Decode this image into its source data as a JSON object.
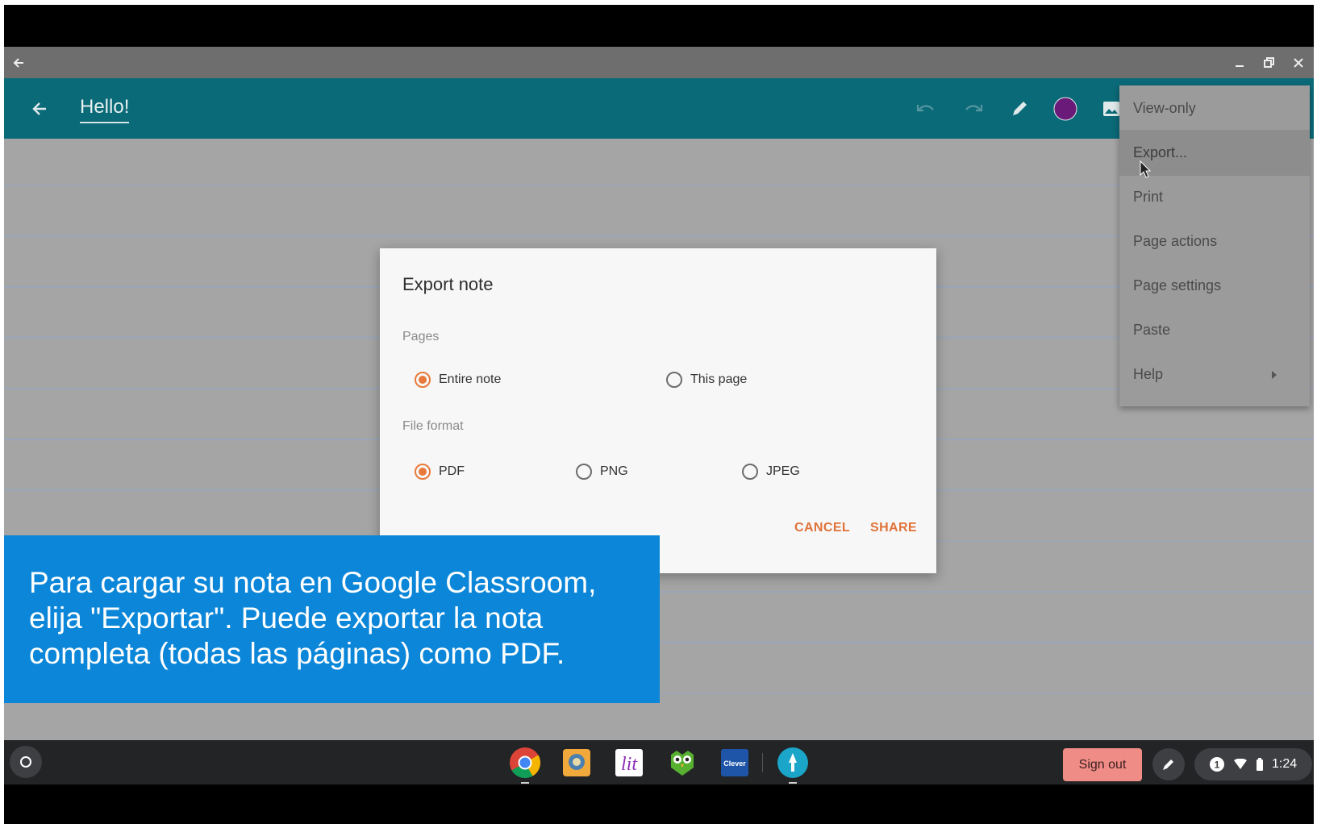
{
  "window": {
    "back_icon": "arrow-left-icon",
    "minimize_icon": "minimize-icon",
    "restore_icon": "restore-icon",
    "close_icon": "close-icon"
  },
  "toolbar": {
    "title": "Hello!",
    "back_icon": "arrow-left-icon",
    "icons": [
      "undo-icon",
      "redo-icon",
      "pen-icon",
      "color-swatch-icon",
      "image-icon"
    ],
    "pen_color": "#6a1b7a",
    "accent": "#0b6a78"
  },
  "menu": {
    "items": [
      {
        "label": "View-only"
      },
      {
        "label": "Export..."
      },
      {
        "label": "Print"
      },
      {
        "label": "Page actions"
      },
      {
        "label": "Page settings"
      },
      {
        "label": "Paste"
      },
      {
        "label": "Help"
      }
    ]
  },
  "dialog": {
    "title": "Export note",
    "pages_label": "Pages",
    "pages_options": [
      {
        "label": "Entire note",
        "selected": true
      },
      {
        "label": "This page",
        "selected": false
      }
    ],
    "format_label": "File format",
    "format_options": [
      {
        "label": "PDF",
        "selected": true
      },
      {
        "label": "PNG",
        "selected": false
      },
      {
        "label": "JPEG",
        "selected": false
      }
    ],
    "cancel": "CANCEL",
    "share": "SHARE",
    "accent": "#e8793a"
  },
  "caption": {
    "lines": [
      "Para cargar su nota en Google Classroom,",
      "elija \"Exportar\". Puede exportar la nota",
      "completa (todas las páginas) como PDF."
    ],
    "background": "#0b86d8"
  },
  "shelf": {
    "apps": [
      "chrome-icon",
      "app-2-icon",
      "lit-app-icon",
      "owl-app-icon",
      "clever-app-icon",
      "squid-app-icon"
    ],
    "clever_label": "Clever",
    "lit_label": "lit",
    "sign_out": "Sign out",
    "notification_count": "1",
    "time": "1:24"
  }
}
